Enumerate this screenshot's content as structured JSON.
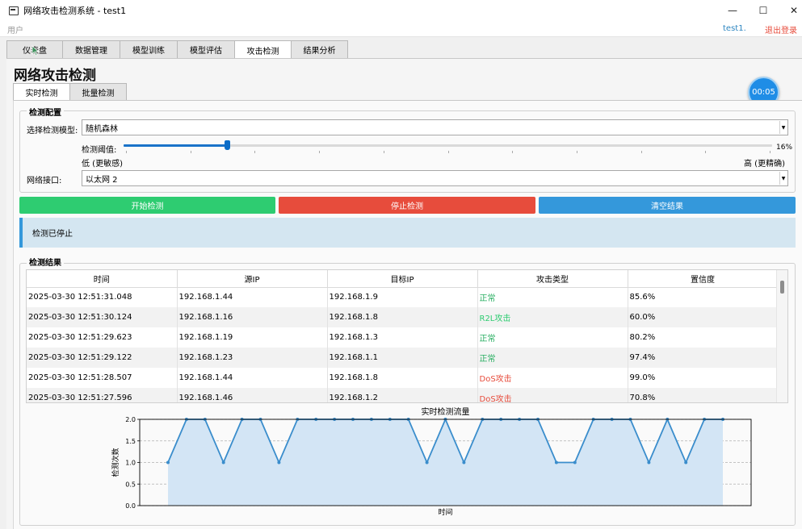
{
  "window": {
    "title": "网络攻击检测系统 - test1"
  },
  "userbar": {
    "user_label": "用户",
    "user_name": "test1.",
    "logout": "退出登录"
  },
  "main_tabs": [
    {
      "label": "仪表盘"
    },
    {
      "label": "数据管理"
    },
    {
      "label": "模型训练"
    },
    {
      "label": "模型评估"
    },
    {
      "label": "攻击检测",
      "active": true
    },
    {
      "label": "结果分析"
    }
  ],
  "page": {
    "title": "网络攻击检测"
  },
  "timer": {
    "value": "00:05"
  },
  "sub_tabs": [
    {
      "label": "实时检测",
      "active": true
    },
    {
      "label": "批量检测"
    }
  ],
  "config": {
    "group_title": "检测配置",
    "model_label": "选择检测模型:",
    "model_value": "随机森林",
    "threshold_label": "检测阈值:",
    "threshold_value": "16%",
    "threshold_level": 0.16,
    "low_label": "低 (更敏感)",
    "high_label": "高 (更精确)",
    "interface_label": "网络接口:",
    "interface_value": "以太网 2"
  },
  "buttons": {
    "start": "开始检测",
    "stop": "停止检测",
    "clear": "清空结果"
  },
  "colors": {
    "start": "#2ecc71",
    "stop": "#e74c3c",
    "clear": "#3498db",
    "normal_text": "#27ae60",
    "r2l_text": "#2ecc71",
    "dos_text": "#e74c3c",
    "status_bg": "#d4e6f1",
    "chart_line": "#3a8dcc",
    "chart_fill": "#d3e5f5"
  },
  "status": {
    "message": "检测已停止"
  },
  "results": {
    "group_title": "检测结果",
    "headers": [
      "时间",
      "源IP",
      "目标IP",
      "攻击类型",
      "置信度"
    ],
    "rows": [
      {
        "time": "2025-03-30 12:51:31.048",
        "src": "192.168.1.44",
        "dst": "192.168.1.9",
        "type": "正常",
        "type_kind": "normal",
        "conf": "85.6%"
      },
      {
        "time": "2025-03-30 12:51:30.124",
        "src": "192.168.1.16",
        "dst": "192.168.1.8",
        "type": "R2L攻击",
        "type_kind": "r2l",
        "conf": "60.0%"
      },
      {
        "time": "2025-03-30 12:51:29.623",
        "src": "192.168.1.19",
        "dst": "192.168.1.3",
        "type": "正常",
        "type_kind": "normal",
        "conf": "80.2%"
      },
      {
        "time": "2025-03-30 12:51:29.122",
        "src": "192.168.1.23",
        "dst": "192.168.1.1",
        "type": "正常",
        "type_kind": "normal",
        "conf": "97.4%"
      },
      {
        "time": "2025-03-30 12:51:28.507",
        "src": "192.168.1.44",
        "dst": "192.168.1.8",
        "type": "DoS攻击",
        "type_kind": "dos",
        "conf": "99.0%"
      },
      {
        "time": "2025-03-30 12:51:27.596",
        "src": "192.168.1.46",
        "dst": "192.168.1.2",
        "type": "DoS攻击",
        "type_kind": "dos",
        "conf": "70.8%"
      }
    ]
  },
  "chart_data": {
    "type": "area",
    "title": "实时检测流量",
    "xlabel": "时间",
    "ylabel": "检测次数",
    "ylim": [
      0,
      2.0
    ],
    "yticks": [
      "0.0",
      "0.5",
      "1.0",
      "1.5",
      "2.0"
    ],
    "grid": true,
    "values": [
      1,
      2,
      2,
      1,
      2,
      2,
      1,
      2,
      2,
      2,
      2,
      2,
      2,
      2,
      1,
      2,
      1,
      2,
      2,
      2,
      2,
      1,
      1,
      2,
      2,
      2,
      1,
      2,
      1,
      2,
      2
    ]
  }
}
